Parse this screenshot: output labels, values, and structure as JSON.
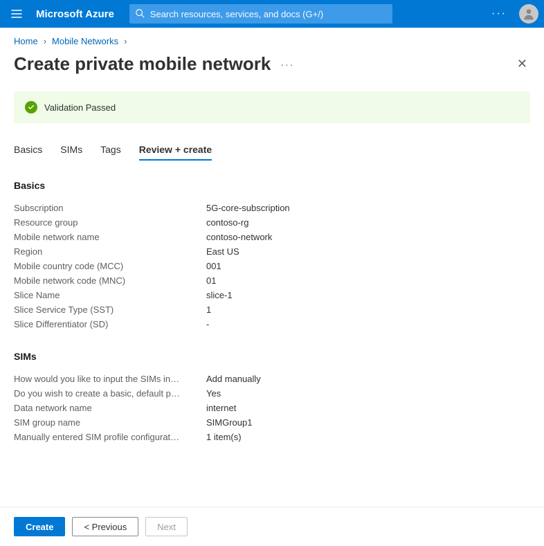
{
  "topbar": {
    "brand": "Microsoft Azure",
    "search_placeholder": "Search resources, services, and docs (G+/)"
  },
  "breadcrumb": {
    "items": [
      "Home",
      "Mobile Networks"
    ]
  },
  "page": {
    "title": "Create private mobile network"
  },
  "validation": {
    "message": "Validation Passed"
  },
  "tabs": {
    "items": [
      "Basics",
      "SIMs",
      "Tags",
      "Review + create"
    ],
    "active_index": 3
  },
  "sections": [
    {
      "title": "Basics",
      "rows": [
        {
          "label": "Subscription",
          "value": "5G-core-subscription"
        },
        {
          "label": "Resource group",
          "value": "contoso-rg"
        },
        {
          "label": "Mobile network name",
          "value": "contoso-network"
        },
        {
          "label": "Region",
          "value": "East US"
        },
        {
          "label": "Mobile country code (MCC)",
          "value": "001"
        },
        {
          "label": "Mobile network code (MNC)",
          "value": "01"
        },
        {
          "label": "Slice Name",
          "value": "slice-1"
        },
        {
          "label": "Slice Service Type (SST)",
          "value": "1"
        },
        {
          "label": "Slice Differentiator (SD)",
          "value": "-"
        }
      ]
    },
    {
      "title": "SIMs",
      "rows": [
        {
          "label": "How would you like to input the SIMs in…",
          "value": "Add manually"
        },
        {
          "label": "Do you wish to create a basic, default p…",
          "value": "Yes"
        },
        {
          "label": "Data network name",
          "value": "internet"
        },
        {
          "label": "SIM group name",
          "value": "SIMGroup1"
        },
        {
          "label": "Manually entered SIM profile configurat…",
          "value": "1 item(s)"
        }
      ]
    }
  ],
  "footer": {
    "create": "Create",
    "previous": "< Previous",
    "next": "Next"
  }
}
